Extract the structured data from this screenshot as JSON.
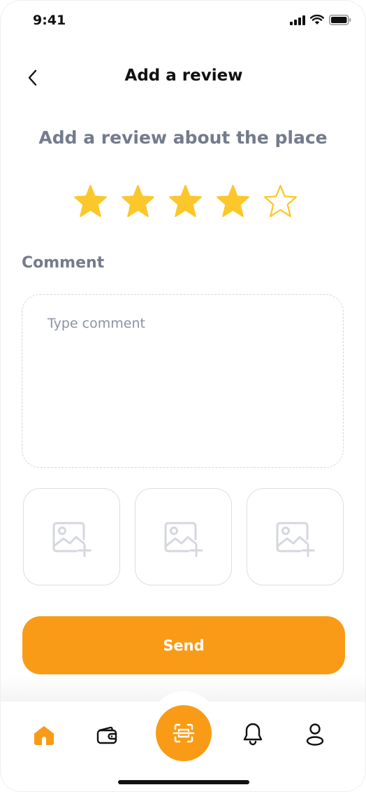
{
  "status_bar": {
    "time": "9:41",
    "icons": [
      "cellular-signal-icon",
      "wifi-icon",
      "battery-icon"
    ]
  },
  "header": {
    "back_icon": "chevron-left-icon",
    "title": "Add a review"
  },
  "review": {
    "heading": "Add a review about the place",
    "rating": 4,
    "max_rating": 5,
    "star_color": "#FBC72A"
  },
  "comment": {
    "label": "Comment",
    "placeholder": "Type comment",
    "value": ""
  },
  "photos": {
    "slots": [
      {
        "icon": "add-image-icon"
      },
      {
        "icon": "add-image-icon"
      },
      {
        "icon": "add-image-icon"
      }
    ]
  },
  "actions": {
    "send_label": "Send"
  },
  "tab_bar": {
    "items": [
      {
        "icon": "home-icon",
        "active": true
      },
      {
        "icon": "wallet-icon",
        "active": false
      },
      {
        "icon": "scan-icon",
        "active": false
      },
      {
        "icon": "bell-icon",
        "active": false
      },
      {
        "icon": "user-icon",
        "active": false
      }
    ]
  },
  "colors": {
    "accent": "#F99B16",
    "heading_gray": "#737B8C",
    "text_dark": "#111111"
  }
}
